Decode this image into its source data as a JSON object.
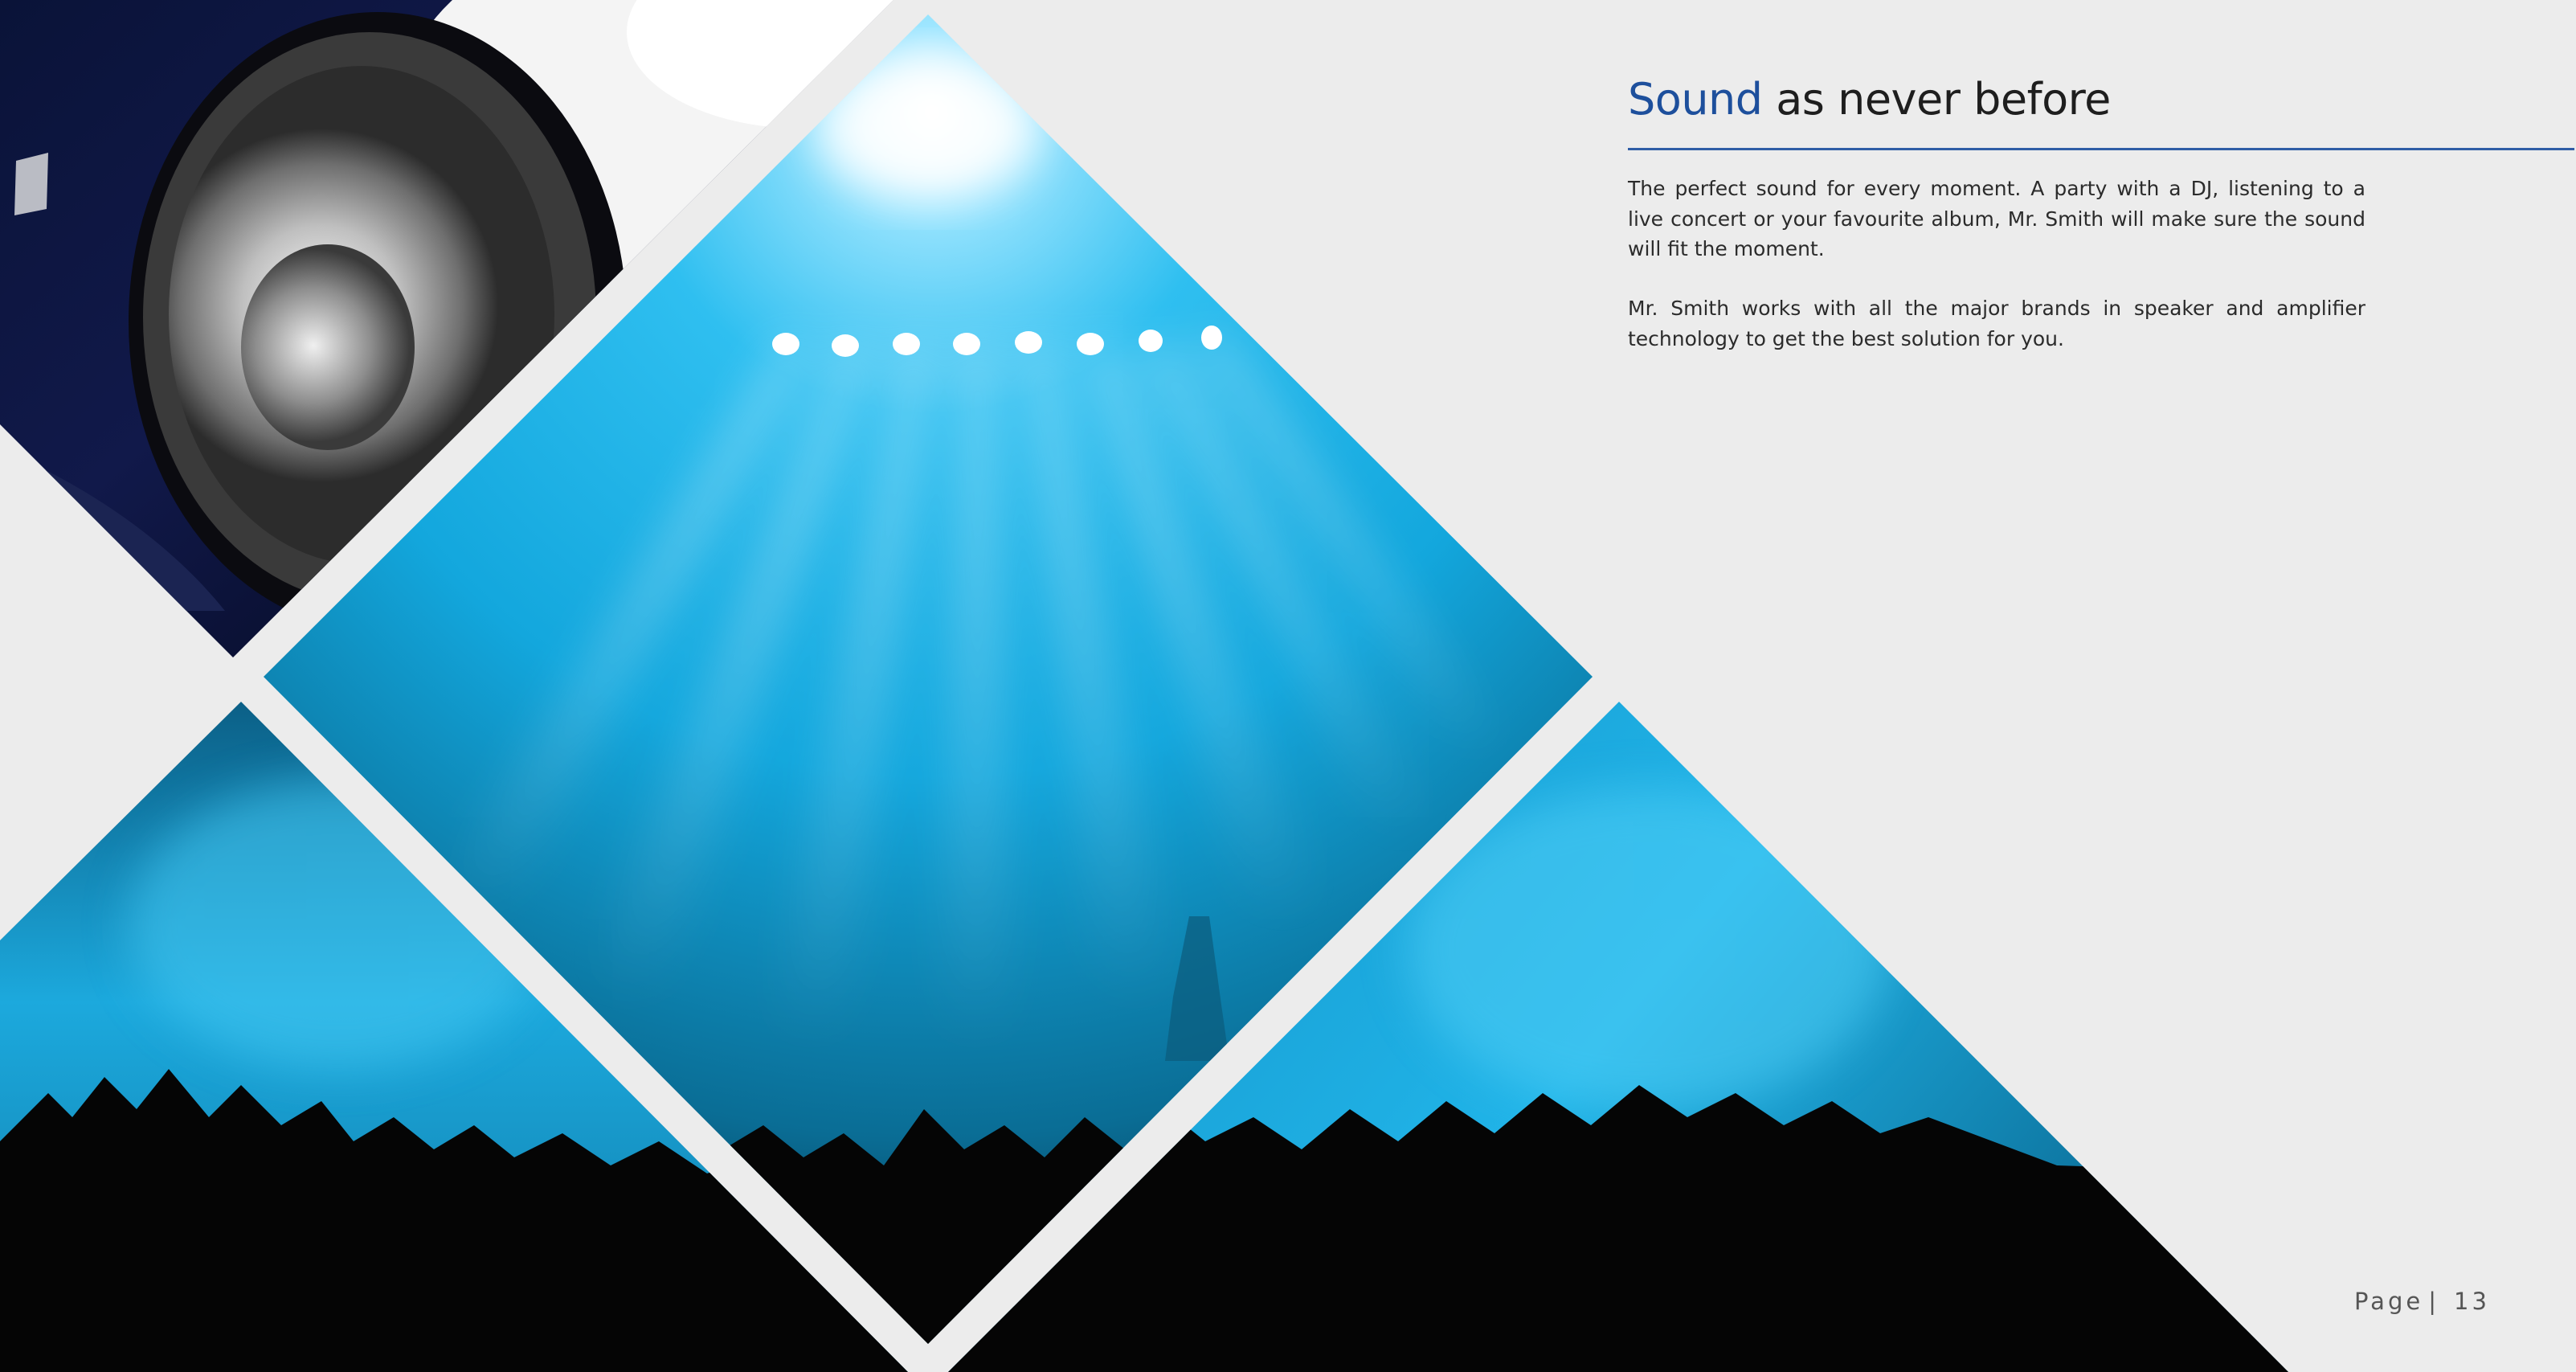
{
  "heading": {
    "accent": "Sound",
    "rest": " as never before"
  },
  "paragraphs": [
    "The perfect sound for every moment. A party with a DJ, listening to a live concert or your favourite album, Mr. Smith will make sure the sound will fit the moment.",
    "Mr. Smith works with all the major brands in speaker and amplifier technology to get the best solution for you."
  ],
  "footer": {
    "page_label": "Page",
    "separator": "|",
    "page_number": "13"
  },
  "colors": {
    "background": "#ececec",
    "accent_blue": "#1d4f9c",
    "rule_blue": "#2f5da6",
    "concert_cyan": "#1fb3e6",
    "crowd_black": "#050505"
  },
  "images": [
    {
      "name": "speaker-photo",
      "subject": "loudspeaker"
    },
    {
      "name": "concert-photo",
      "subject": "stage lights and crowd"
    }
  ]
}
